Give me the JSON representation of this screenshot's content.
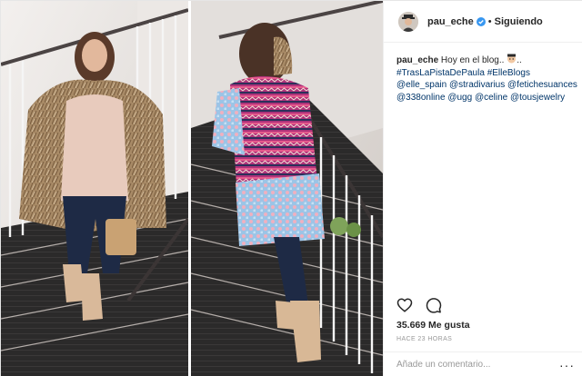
{
  "post": {
    "author": "pau_eche",
    "follow_status": "Siguiendo",
    "separator": "•",
    "caption": {
      "username": "pau_eche",
      "text": "Hoy en el blog..",
      "tail": "..",
      "tags": [
        "#TrasLaPistaDePaula",
        "#ElleBlogs",
        "@elle_spain",
        "@stradivarius",
        "@fetichesuances",
        "@338online",
        "@ugg",
        "@celine",
        "@tousjewelry"
      ]
    },
    "likes": "35.669 Me gusta",
    "timestamp": "HACE 23 HORAS",
    "comment_placeholder": "Añade un comentario...",
    "more_label": "···"
  },
  "icons": {
    "verified": "verified-badge-icon",
    "like": "heart-icon",
    "comment": "comment-bubble-icon",
    "more": "more-options-icon",
    "emoji": "face-emoji-icon"
  },
  "colors": {
    "link": "#003569",
    "verified": "#3897f0",
    "muted": "#999999",
    "text": "#262626"
  }
}
